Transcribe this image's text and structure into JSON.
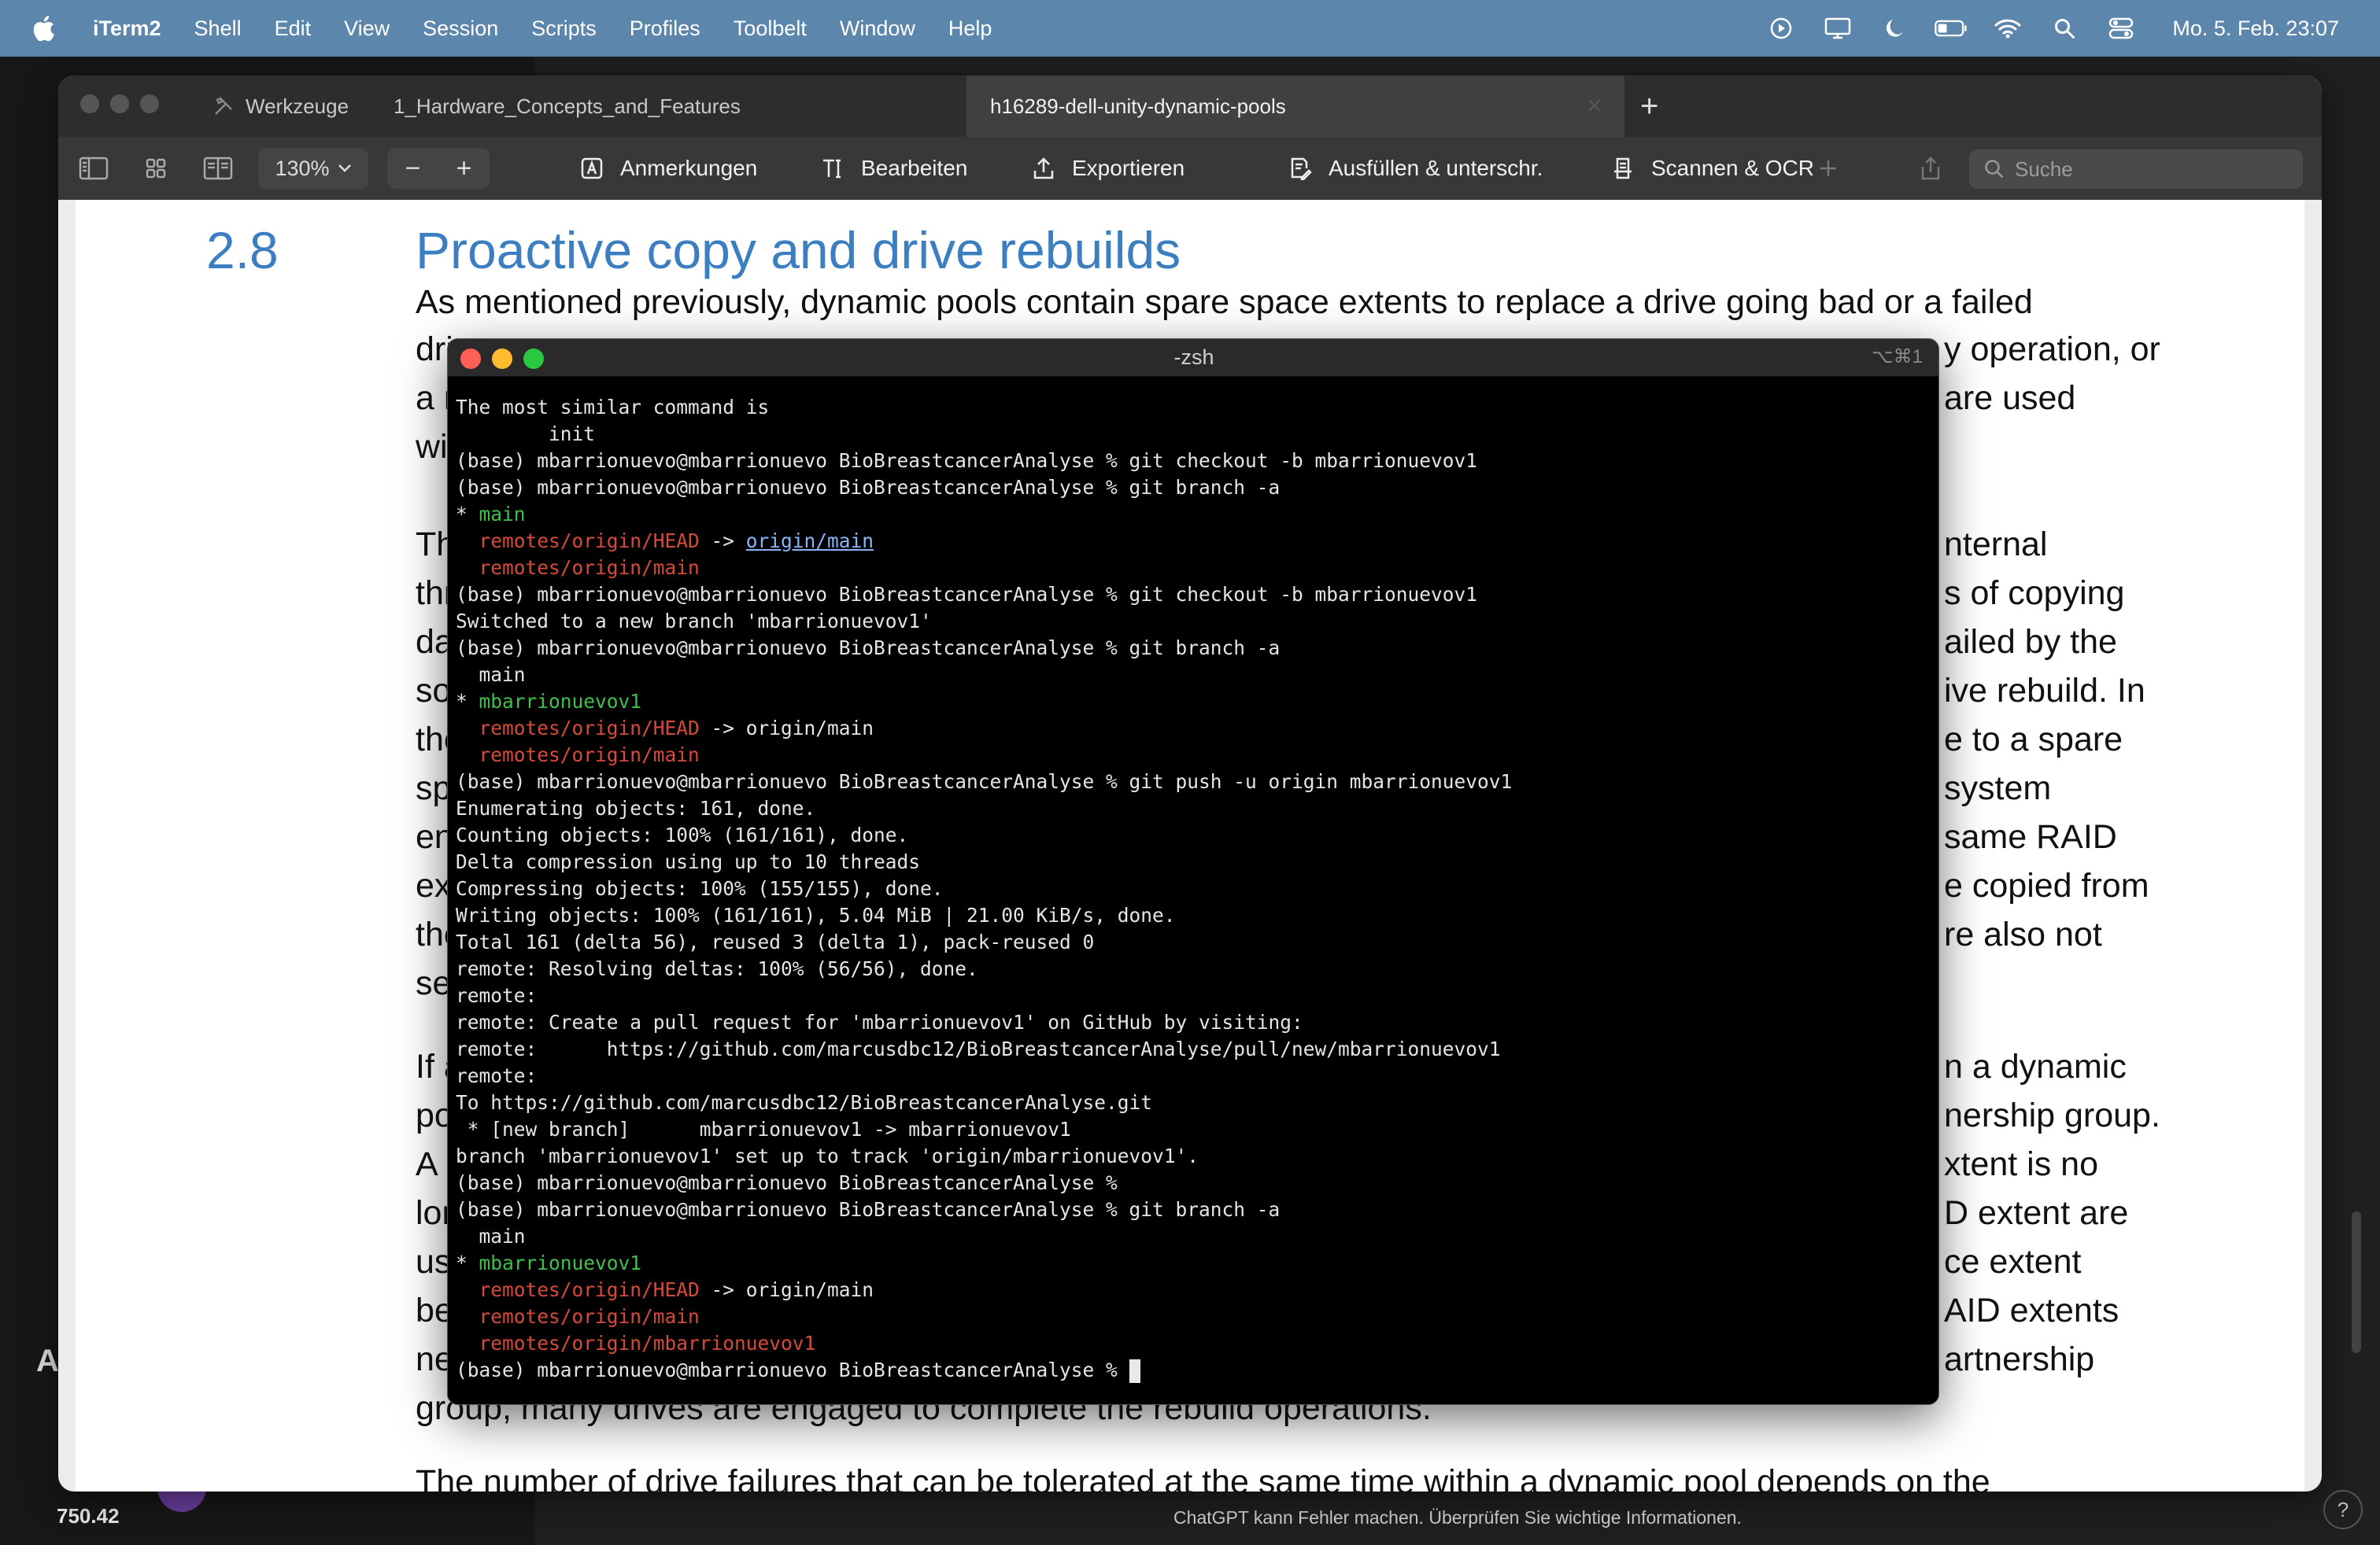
{
  "menubar": {
    "apple": "",
    "items": [
      "iTerm2",
      "Shell",
      "Edit",
      "View",
      "Session",
      "Scripts",
      "Profiles",
      "Toolbelt",
      "Window",
      "Help"
    ],
    "clock": "Mo. 5. Feb.  23:07"
  },
  "background_app": {
    "price": "750.42",
    "letter": "A",
    "footer": "ChatGPT kann Fehler machen. Überprüfen Sie wichtige Informationen.",
    "help": "?"
  },
  "preview": {
    "tabs": [
      "Werkzeuge",
      "1_Hardware_Concepts_and_Features",
      "h16289-dell-unity-dynamic-pools"
    ],
    "new_tab": "+",
    "zoom": "130%",
    "zoom_minus": "−",
    "zoom_plus": "+",
    "toolbar": {
      "annotate": "Anmerkungen",
      "edit": "Bearbeiten",
      "export": "Exportieren",
      "fill_sign": "Ausfüllen & unterschr.",
      "scan": "Scannen & OCR"
    },
    "search_placeholder": "Suche",
    "document": {
      "section_number": "2.8",
      "section_title": "Proactive copy and drive rebuilds",
      "line1": "As mentioned previously, dynamic pools contain spare space extents to replace a drive going bad or a failed",
      "left_fragments": [
        "dri",
        "a r",
        "wit",
        "Th",
        "thr",
        "da",
        "so",
        "the",
        "spa",
        "ens",
        "ext",
        "the",
        "sel",
        "If a",
        "poo",
        "A R",
        "lon",
        "use",
        "bee",
        "nee",
        "group, many drives are engaged to complete the rebuild operations."
      ],
      "right_fragments": [
        "y operation, or",
        "are used",
        "nternal",
        "s of copying",
        "ailed by the",
        "ive rebuild. In",
        "e to a spare",
        "system",
        "same RAID",
        "e copied from",
        "re also not",
        "n a dynamic",
        "nership group.",
        "xtent is no",
        "D extent are",
        "ce extent",
        "AID extents",
        "artnership"
      ],
      "bottom_line": "The number of drive failures that can be tolerated at the same time within a dynamic pool depends on the"
    }
  },
  "terminal": {
    "title": "-zsh",
    "shortcut": "⌥⌘1",
    "prompt": "(base) mbarrionuevo@mbarrionuevo BioBreastcancerAnalyse %",
    "lines": {
      "l1": "The most similar command is",
      "l2": "        init",
      "l3": " git checkout -b mbarrionuevov1",
      "l4": " git branch -a",
      "l5_star": "* ",
      "l5_main": "main",
      "l6_remote_head": "  remotes/origin/HEAD",
      "l6_arrow": " -> ",
      "l6_link": "origin/main",
      "l7_remote_main": "  remotes/origin/main",
      "l8": " git checkout -b mbarrionuevov1",
      "l9": "Switched to a new branch 'mbarrionuevov1'",
      "l10": " git branch -a",
      "l11": "  main",
      "l12_star": "* ",
      "l12_branch": "mbarrionuevov1",
      "l13_remote_head": "  remotes/origin/HEAD",
      "l13_rest": " -> origin/main",
      "l14_remote_main": "  remotes/origin/main",
      "l15": " git push -u origin mbarrionuevov1",
      "l16": "Enumerating objects: 161, done.",
      "l17": "Counting objects: 100% (161/161), done.",
      "l18": "Delta compression using up to 10 threads",
      "l19": "Compressing objects: 100% (155/155), done.",
      "l20": "Writing objects: 100% (161/161), 5.04 MiB | 21.00 KiB/s, done.",
      "l21": "Total 161 (delta 56), reused 3 (delta 1), pack-reused 0",
      "l22": "remote: Resolving deltas: 100% (56/56), done.",
      "l23": "remote:",
      "l24": "remote: Create a pull request for 'mbarrionuevov1' on GitHub by visiting:",
      "l25": "remote:      https://github.com/marcusdbc12/BioBreastcancerAnalyse/pull/new/mbarrionuevov1",
      "l26": "remote:",
      "l27": "To https://github.com/marcusdbc12/BioBreastcancerAnalyse.git",
      "l28": " * [new branch]      mbarrionuevov1 -> mbarrionuevov1",
      "l29": "branch 'mbarrionuevov1' set up to track 'origin/mbarrionuevov1'.",
      "l30": "",
      "l31": " git branch -a",
      "l32": "  main",
      "l33_star": "* ",
      "l33_branch": "mbarrionuevov1",
      "l34_remote_head": "  remotes/origin/HEAD",
      "l34_rest": " -> origin/main",
      "l35_remote_main": "  remotes/origin/main",
      "l36_remote_branch": "  remotes/origin/mbarrionuevov1",
      "l37": " "
    }
  },
  "colors": {
    "menubar": "#5c86ab",
    "heading_blue": "#3b7ec2",
    "term_green": "#3fc04a",
    "term_red": "#d64a3a"
  }
}
